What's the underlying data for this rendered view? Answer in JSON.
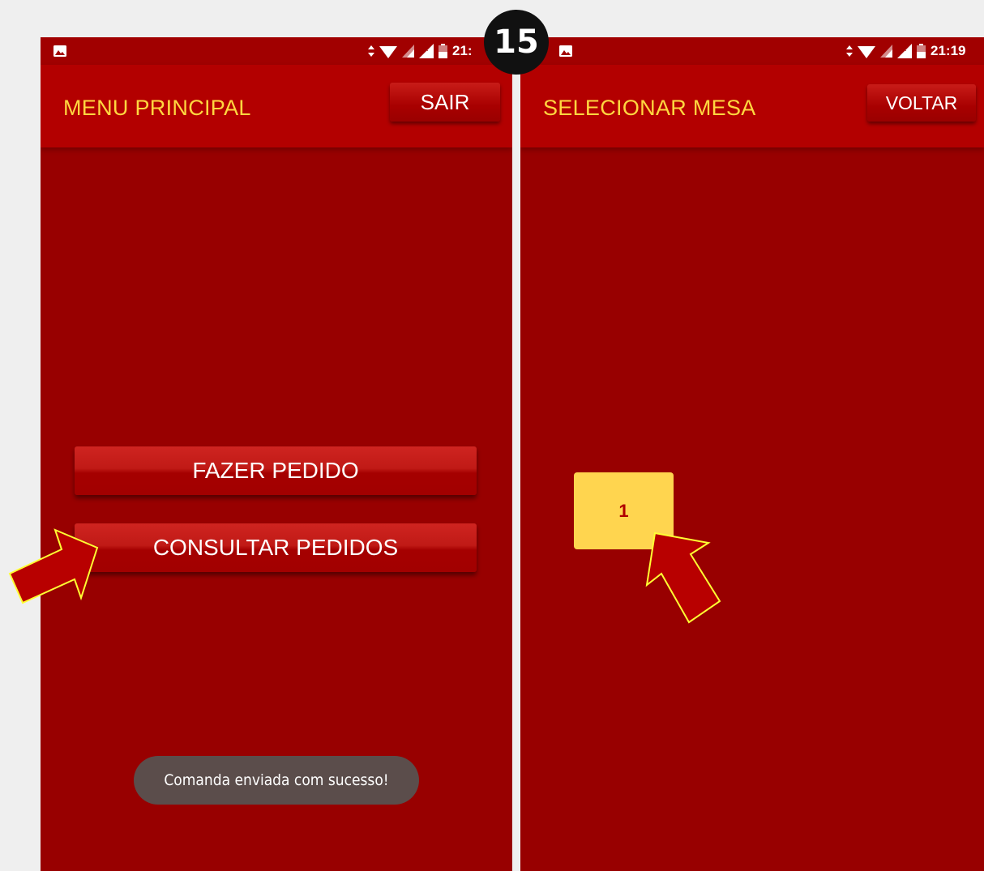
{
  "step_badge": "15",
  "left_screen": {
    "status_time": "21:",
    "title": "MENU PRINCIPAL",
    "exit_button": "SAIR",
    "buttons": [
      {
        "label": "FAZER PEDIDO"
      },
      {
        "label": "CONSULTAR PEDIDOS"
      }
    ],
    "toast": "Comanda enviada com sucesso!"
  },
  "right_screen": {
    "status_time": "21:19",
    "title": "SELECIONAR MESA",
    "back_button": "VOLTAR",
    "tables": [
      {
        "number": "1"
      }
    ]
  },
  "colors": {
    "background": "#980000",
    "appbar": "#b30000",
    "title_text": "#ffd740",
    "table_tile": "#ffd54f",
    "toast": "#5b4d4b",
    "arrow_fill": "#b80000",
    "arrow_outline": "#ffff33"
  },
  "icons": [
    "gallery-icon",
    "data-arrows-icon",
    "wifi-icon",
    "signal-icon",
    "no-signal-icon",
    "battery-icon",
    "pointer-arrow-icon"
  ]
}
